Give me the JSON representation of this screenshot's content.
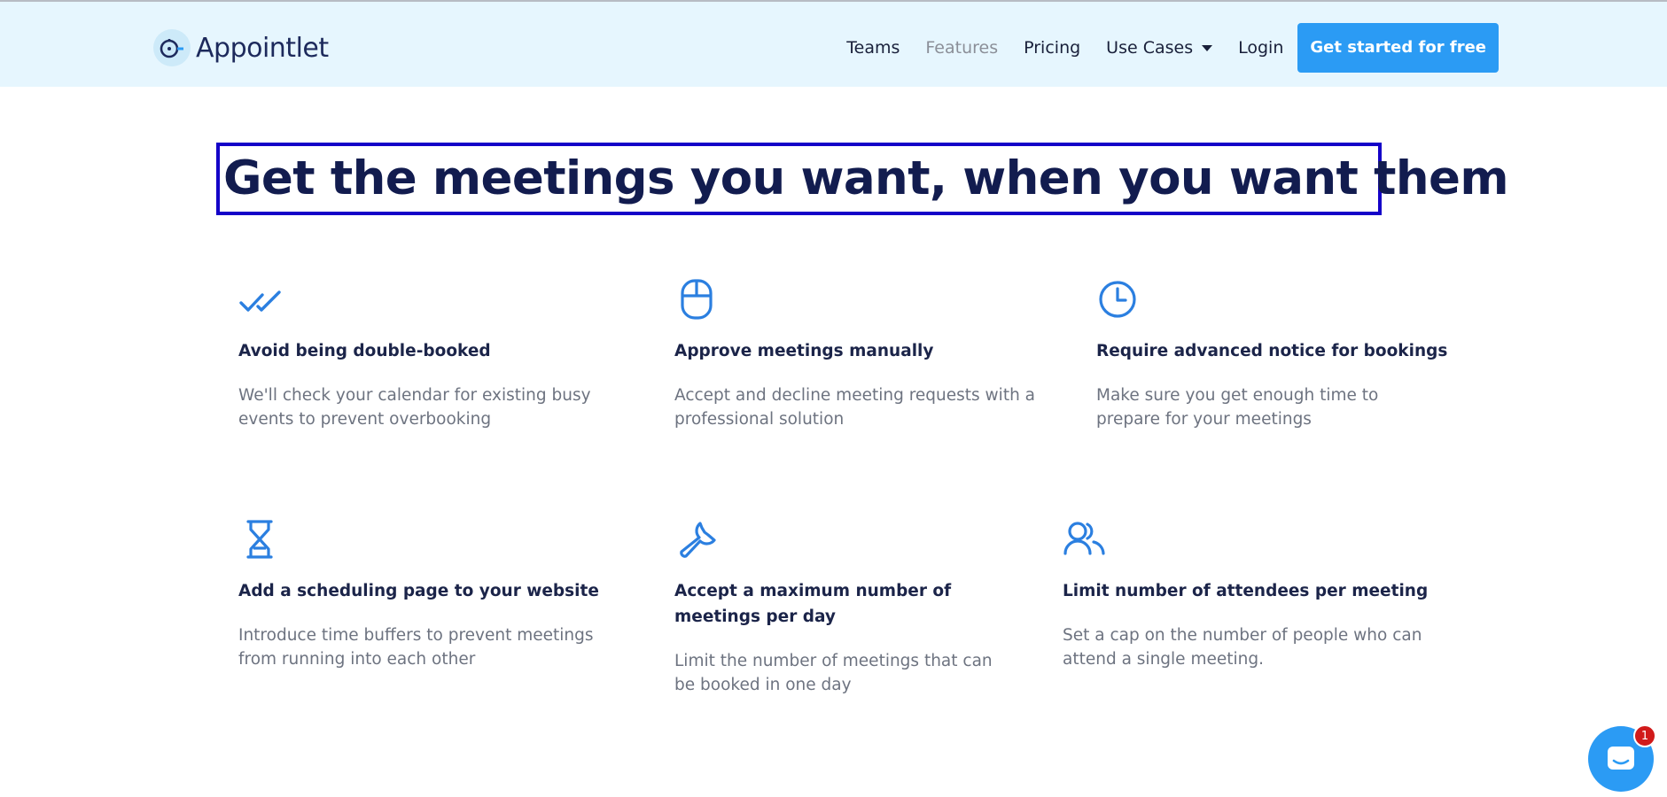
{
  "brand": {
    "name": "Appointlet"
  },
  "nav": {
    "teams": "Teams",
    "features": "Features",
    "pricing": "Pricing",
    "use_cases": "Use Cases",
    "login": "Login",
    "cta": "Get started for free"
  },
  "headline": "Get the meetings you want, when you want them",
  "features": [
    {
      "icon": "double-check-icon",
      "title": "Avoid being double-booked",
      "desc_1": "We'll check your calendar for existing busy",
      "desc_2": "events to prevent overbooking"
    },
    {
      "icon": "mouse-icon",
      "title": "Approve meetings manually",
      "desc_1": "Accept and decline meeting requests with a",
      "desc_2": "professional solution"
    },
    {
      "icon": "clock-icon",
      "title": "Require advanced notice for bookings",
      "desc_1": "Make sure you get enough time to",
      "desc_2": "prepare for your meetings"
    },
    {
      "icon": "hourglass-icon",
      "title": "Add a scheduling page to your website",
      "desc_1": "Introduce time buffers to prevent meetings",
      "desc_2": "from running into each other"
    },
    {
      "icon": "wrench-icon",
      "title_1": "Accept a maximum number of",
      "title_2": "meetings per day",
      "desc_1": "Limit the number of meetings that can",
      "desc_2": "be booked in one day"
    },
    {
      "icon": "users-icon",
      "title": "Limit number of attendees per meeting",
      "desc_1": "Set a cap on the number of people who can",
      "desc_2": "attend a single meeting."
    }
  ],
  "chat": {
    "badge_count": "1"
  },
  "colors": {
    "accent": "#2b9bf4",
    "navbar_bg": "#e6f6fe",
    "headline": "#121c4f",
    "highlight_border": "#1400c8",
    "badge": "#d11a1a"
  }
}
